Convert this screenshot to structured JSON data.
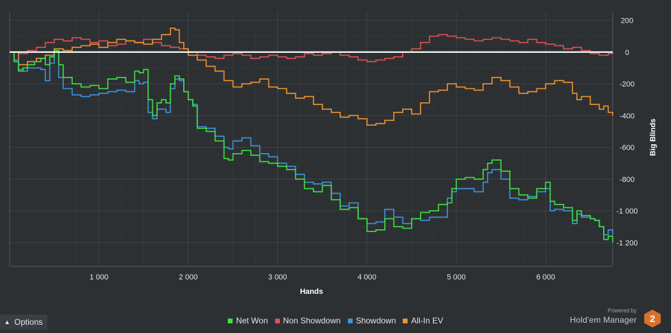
{
  "legend": [
    {
      "name": "Net Won",
      "color": "#3fe03f"
    },
    {
      "name": "Non Showdown",
      "color": "#e0504f"
    },
    {
      "name": "Showdown",
      "color": "#3a95de"
    },
    {
      "name": "All-In EV",
      "color": "#ef9330"
    }
  ],
  "options": {
    "label": "Options",
    "icon": "chevron-up-icon"
  },
  "brand": {
    "powered_by": "Powered by",
    "name": "Hold'em Manager",
    "logo_text": "2",
    "logo_color": "#d9702c"
  },
  "colors": {
    "background": "#2d3033",
    "grid": "#3f4347",
    "zero_line": "#ffffff"
  },
  "chart_data": {
    "type": "line",
    "xlabel": "Hands",
    "ylabel": "Big Blinds",
    "xlim": [
      0,
      6750
    ],
    "ylim": [
      -1350,
      250
    ],
    "x_ticks": [
      1000,
      2000,
      3000,
      4000,
      5000,
      6000
    ],
    "x_tick_labels": [
      "1 000",
      "2 000",
      "3 000",
      "4 000",
      "5 000",
      "6 000"
    ],
    "y_ticks": [
      200,
      0,
      -200,
      -400,
      -600,
      -800,
      -1000,
      -1200
    ],
    "y_tick_labels": [
      "200",
      "0",
      "-200",
      "-400",
      "-600",
      "-800",
      "-1 000",
      "-1 200"
    ],
    "grid": true,
    "y_axis_position": "right",
    "zero_line": true,
    "legend_position": "bottom",
    "series": [
      {
        "name": "Net Won",
        "color": "#3fe03f",
        "x": [
          0,
          50,
          100,
          150,
          200,
          280,
          350,
          400,
          450,
          500,
          550,
          600,
          700,
          800,
          900,
          1000,
          1100,
          1200,
          1300,
          1400,
          1450,
          1500,
          1550,
          1600,
          1650,
          1700,
          1750,
          1800,
          1850,
          1900,
          1950,
          2000,
          2050,
          2100,
          2200,
          2300,
          2400,
          2450,
          2500,
          2600,
          2700,
          2800,
          2900,
          3000,
          3100,
          3200,
          3300,
          3400,
          3500,
          3600,
          3700,
          3800,
          3900,
          4000,
          4100,
          4200,
          4300,
          4400,
          4500,
          4600,
          4700,
          4800,
          4900,
          4950,
          5000,
          5100,
          5200,
          5300,
          5350,
          5400,
          5500,
          5600,
          5700,
          5800,
          5900,
          6000,
          6050,
          6100,
          6200,
          6300,
          6350,
          6400,
          6500,
          6550,
          6600,
          6650,
          6700,
          6750
        ],
        "values": [
          0,
          -60,
          -120,
          -100,
          -80,
          -60,
          -40,
          -80,
          -30,
          10,
          -80,
          -160,
          -200,
          -220,
          -210,
          -230,
          -170,
          -160,
          -190,
          -120,
          -130,
          -110,
          -300,
          -400,
          -320,
          -300,
          -320,
          -200,
          -150,
          -170,
          -250,
          -300,
          -340,
          -480,
          -500,
          -560,
          -670,
          -680,
          -640,
          -620,
          -650,
          -690,
          -700,
          -720,
          -740,
          -800,
          -860,
          -880,
          -840,
          -930,
          -990,
          -980,
          -1050,
          -1130,
          -1120,
          -1050,
          -1100,
          -1110,
          -1050,
          -1010,
          -1000,
          -960,
          -950,
          -860,
          -800,
          -790,
          -800,
          -740,
          -700,
          -680,
          -750,
          -860,
          -900,
          -920,
          -860,
          -820,
          -940,
          -960,
          -980,
          -1060,
          -1000,
          -1030,
          -1050,
          -1060,
          -1100,
          -1180,
          -1160,
          -1200
        ]
      },
      {
        "name": "Non Showdown",
        "color": "#e0504f",
        "x": [
          0,
          100,
          200,
          300,
          400,
          500,
          600,
          700,
          800,
          900,
          1000,
          1100,
          1200,
          1300,
          1400,
          1500,
          1600,
          1700,
          1800,
          1900,
          2000,
          2100,
          2200,
          2300,
          2400,
          2500,
          2600,
          2700,
          2800,
          2900,
          3000,
          3100,
          3200,
          3300,
          3400,
          3500,
          3600,
          3700,
          3800,
          3900,
          4000,
          4100,
          4200,
          4300,
          4400,
          4500,
          4600,
          4700,
          4800,
          4900,
          5000,
          5100,
          5200,
          5300,
          5400,
          5500,
          5600,
          5700,
          5800,
          5900,
          6000,
          6100,
          6200,
          6300,
          6400,
          6500,
          6600,
          6700,
          6750
        ],
        "values": [
          0,
          -10,
          10,
          30,
          60,
          80,
          70,
          90,
          80,
          60,
          70,
          40,
          50,
          70,
          60,
          80,
          60,
          40,
          30,
          20,
          0,
          -20,
          -30,
          -40,
          -20,
          -10,
          -20,
          -40,
          -30,
          -20,
          -30,
          -40,
          -30,
          -10,
          -20,
          -10,
          0,
          -20,
          -30,
          -50,
          -60,
          -50,
          -40,
          -30,
          0,
          20,
          60,
          100,
          110,
          100,
          90,
          80,
          70,
          80,
          90,
          80,
          70,
          60,
          80,
          60,
          50,
          40,
          20,
          30,
          10,
          -10,
          -20,
          -10,
          0
        ]
      },
      {
        "name": "Showdown",
        "color": "#3a95de",
        "x": [
          0,
          50,
          100,
          150,
          200,
          280,
          350,
          400,
          450,
          500,
          550,
          600,
          700,
          800,
          900,
          1000,
          1100,
          1200,
          1300,
          1400,
          1450,
          1500,
          1550,
          1600,
          1650,
          1700,
          1750,
          1800,
          1850,
          1900,
          1950,
          2000,
          2050,
          2100,
          2200,
          2300,
          2400,
          2450,
          2500,
          2600,
          2700,
          2800,
          2900,
          3000,
          3100,
          3200,
          3300,
          3400,
          3500,
          3600,
          3700,
          3800,
          3900,
          4000,
          4100,
          4200,
          4300,
          4400,
          4500,
          4600,
          4700,
          4800,
          4900,
          4950,
          5000,
          5100,
          5200,
          5300,
          5350,
          5400,
          5500,
          5600,
          5700,
          5800,
          5900,
          6000,
          6050,
          6100,
          6200,
          6300,
          6350,
          6400,
          6500,
          6550,
          6600,
          6650,
          6700,
          6750
        ],
        "values": [
          0,
          -50,
          -110,
          -120,
          -100,
          -100,
          -110,
          -180,
          -70,
          0,
          -160,
          -230,
          -270,
          -280,
          -270,
          -260,
          -250,
          -240,
          -250,
          -180,
          -200,
          -190,
          -380,
          -420,
          -360,
          -360,
          -380,
          -230,
          -170,
          -180,
          -250,
          -300,
          -330,
          -470,
          -480,
          -530,
          -600,
          -610,
          -560,
          -540,
          -590,
          -640,
          -660,
          -700,
          -720,
          -770,
          -820,
          -830,
          -820,
          -890,
          -970,
          -950,
          -1050,
          -1080,
          -1070,
          -990,
          -1040,
          -1080,
          -1050,
          -1060,
          -1040,
          -1040,
          -920,
          -880,
          -860,
          -860,
          -880,
          -820,
          -760,
          -740,
          -800,
          -920,
          -930,
          -910,
          -880,
          -860,
          -1000,
          -990,
          -1000,
          -1080,
          -1020,
          -1040,
          -1050,
          -1060,
          -1100,
          -1150,
          -1120,
          -1150
        ]
      },
      {
        "name": "All-In EV",
        "color": "#ef9330",
        "x": [
          0,
          100,
          200,
          300,
          400,
          500,
          600,
          700,
          800,
          900,
          1000,
          1100,
          1200,
          1300,
          1400,
          1500,
          1600,
          1700,
          1800,
          1850,
          1900,
          1950,
          2000,
          2100,
          2200,
          2300,
          2400,
          2500,
          2600,
          2700,
          2800,
          2900,
          3000,
          3100,
          3200,
          3300,
          3400,
          3500,
          3600,
          3700,
          3800,
          3900,
          4000,
          4100,
          4200,
          4300,
          4400,
          4500,
          4600,
          4700,
          4800,
          4900,
          5000,
          5100,
          5200,
          5300,
          5400,
          5500,
          5600,
          5700,
          5800,
          5900,
          6000,
          6100,
          6200,
          6300,
          6350,
          6400,
          6500,
          6600,
          6650,
          6700,
          6750
        ],
        "values": [
          0,
          -80,
          -60,
          -40,
          -20,
          20,
          10,
          30,
          40,
          50,
          30,
          60,
          80,
          70,
          60,
          50,
          80,
          110,
          150,
          140,
          60,
          20,
          -20,
          -50,
          -90,
          -120,
          -180,
          -220,
          -200,
          -190,
          -170,
          -220,
          -230,
          -260,
          -290,
          -280,
          -330,
          -360,
          -380,
          -410,
          -400,
          -420,
          -460,
          -450,
          -430,
          -380,
          -360,
          -390,
          -320,
          -250,
          -240,
          -200,
          -220,
          -230,
          -240,
          -200,
          -160,
          -180,
          -220,
          -260,
          -250,
          -230,
          -200,
          -180,
          -190,
          -260,
          -300,
          -280,
          -330,
          -360,
          -340,
          -380,
          -400
        ]
      }
    ]
  }
}
